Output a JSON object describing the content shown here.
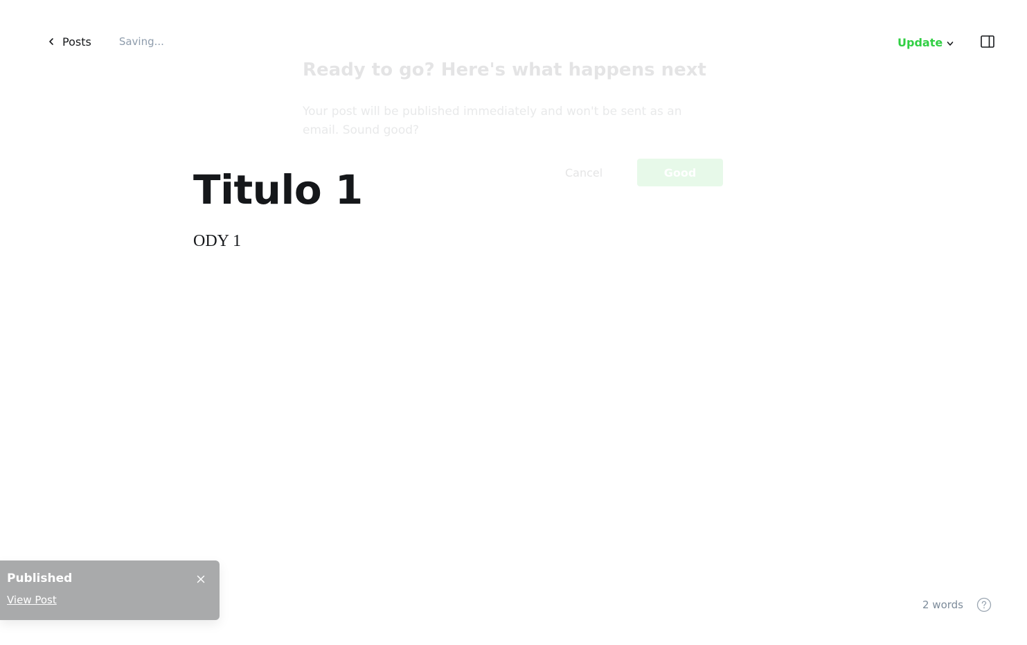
{
  "header": {
    "back_label": "Posts",
    "save_status": "Saving...",
    "update_label": "Update"
  },
  "modal": {
    "title": "Ready to go? Here's what happens next",
    "text": "Your post will be published immediately and won't be sent as an email. Sound good?",
    "cancel_label": "Cancel",
    "confirm_label": "Good"
  },
  "editor": {
    "title": "Titulo 1",
    "body": "ODY 1"
  },
  "toast": {
    "title": "Published",
    "link_label": "View Post"
  },
  "footer": {
    "word_count": "2 words"
  },
  "colors": {
    "accent": "#30cf43",
    "toast_bg": "#a9aaab",
    "muted_text": "#8e9cac"
  },
  "icons": [
    "chevron-left-icon",
    "chevron-down-icon",
    "sidebar-panel-icon",
    "close-icon",
    "help-icon"
  ]
}
